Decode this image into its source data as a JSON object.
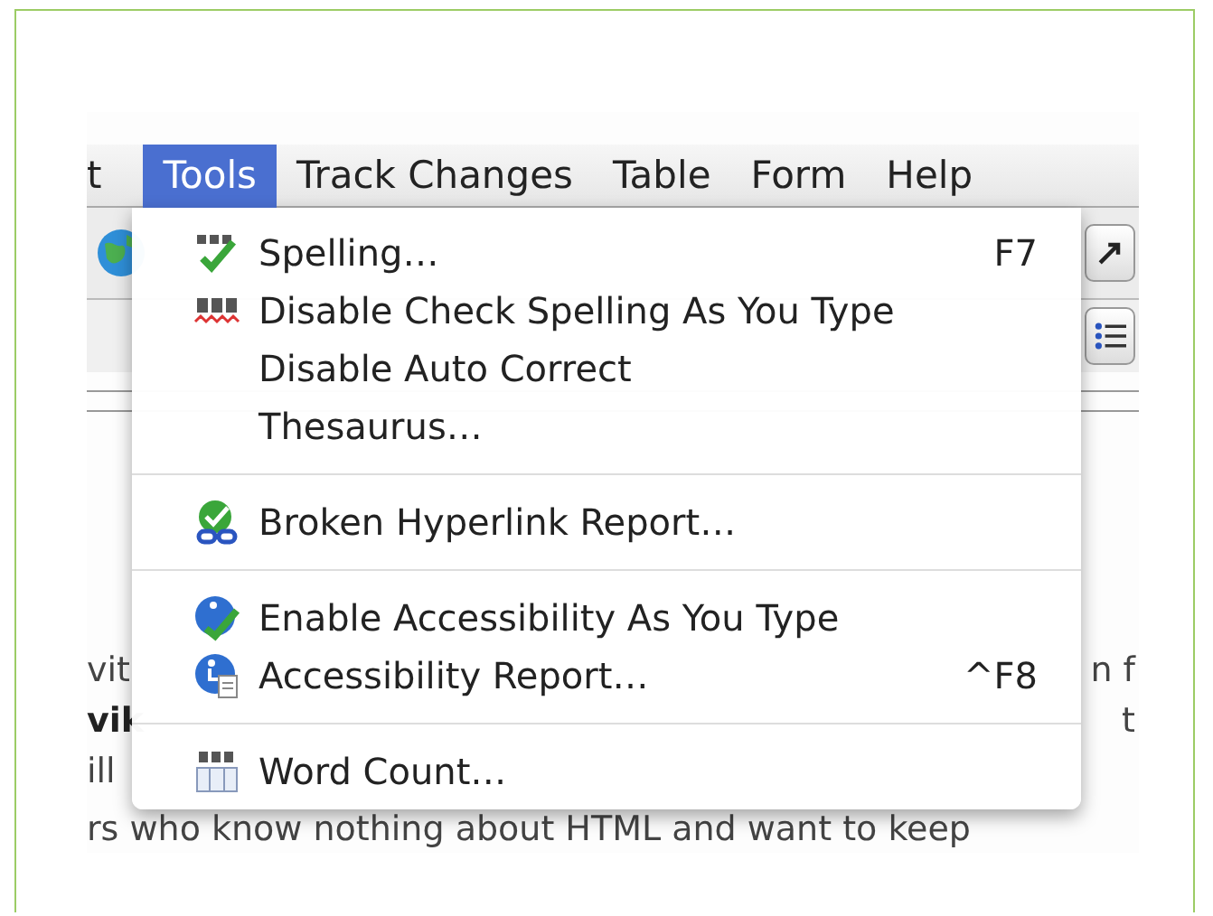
{
  "menubar": [
    {
      "label": "t",
      "selected": false
    },
    {
      "label": "Tools",
      "selected": true
    },
    {
      "label": "Track Changes",
      "selected": false
    },
    {
      "label": "Table",
      "selected": false
    },
    {
      "label": "Form",
      "selected": false
    },
    {
      "label": "Help",
      "selected": false
    }
  ],
  "menu": {
    "items": [
      {
        "kind": "item",
        "label": "Spelling…",
        "shortcut": "F7"
      },
      {
        "kind": "item",
        "label": "Disable Check Spelling As You Type"
      },
      {
        "kind": "item",
        "label": "Disable Auto Correct"
      },
      {
        "kind": "item",
        "label": "Thesaurus…"
      },
      {
        "kind": "separator"
      },
      {
        "kind": "item",
        "label": "Broken Hyperlink Report…"
      },
      {
        "kind": "separator"
      },
      {
        "kind": "item",
        "label": "Enable Accessibility As You Type"
      },
      {
        "kind": "item",
        "label": "Accessibility Report…",
        "shortcut": "^F8"
      },
      {
        "kind": "separator"
      },
      {
        "kind": "item",
        "label": "Word Count…"
      }
    ]
  },
  "document": {
    "lines": [
      {
        "start": "vit",
        "start_bold": false,
        "end": "n f"
      },
      {
        "start": "vik",
        "start_bold": true,
        "end": "t"
      },
      {
        "start": "ill",
        "start_bold": false
      },
      {
        "start_bold": false,
        "start": "rs who know nothing about HTML and want to keep"
      }
    ]
  }
}
